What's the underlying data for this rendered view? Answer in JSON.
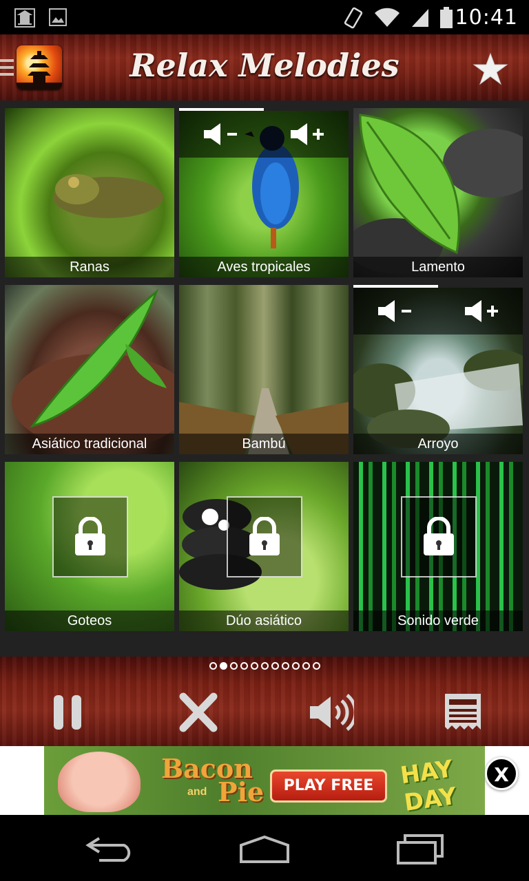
{
  "status_bar": {
    "time": "10:41",
    "icons": [
      "app-notification-icon",
      "image-notification-icon",
      "rotation-icon",
      "wifi-icon",
      "signal-icon",
      "battery-icon"
    ]
  },
  "header": {
    "title": "Relax Melodies",
    "icons": [
      "menu-icon",
      "app-logo-icon",
      "star-icon"
    ]
  },
  "sounds": [
    {
      "label": "Ranas",
      "locked": false,
      "active": false
    },
    {
      "label": "Aves tropicales",
      "locked": false,
      "active": true
    },
    {
      "label": "Lamento",
      "locked": false,
      "active": false
    },
    {
      "label": "Asiático tradicional",
      "locked": false,
      "active": false
    },
    {
      "label": "Bambú",
      "locked": false,
      "active": false
    },
    {
      "label": "Arroyo",
      "locked": false,
      "active": true
    },
    {
      "label": "Goteos",
      "locked": true,
      "active": false
    },
    {
      "label": "Dúo asiático",
      "locked": true,
      "active": false
    },
    {
      "label": "Sonido verde",
      "locked": true,
      "active": false
    }
  ],
  "pager": {
    "total": 11,
    "current": 2
  },
  "controls": [
    "pause-icon",
    "close-icon",
    "volume-icon",
    "timer-list-icon"
  ],
  "ad": {
    "word_1": "Bacon",
    "word_2": "and",
    "word_3": "Pie",
    "button": "PLAY FREE",
    "brand_1": "HAY",
    "brand_2": "DAY",
    "close": "X"
  },
  "colors": {
    "wood_dark": "#5a1410",
    "wood_mid": "#8a2a1c",
    "accent_white": "#ffffff"
  }
}
